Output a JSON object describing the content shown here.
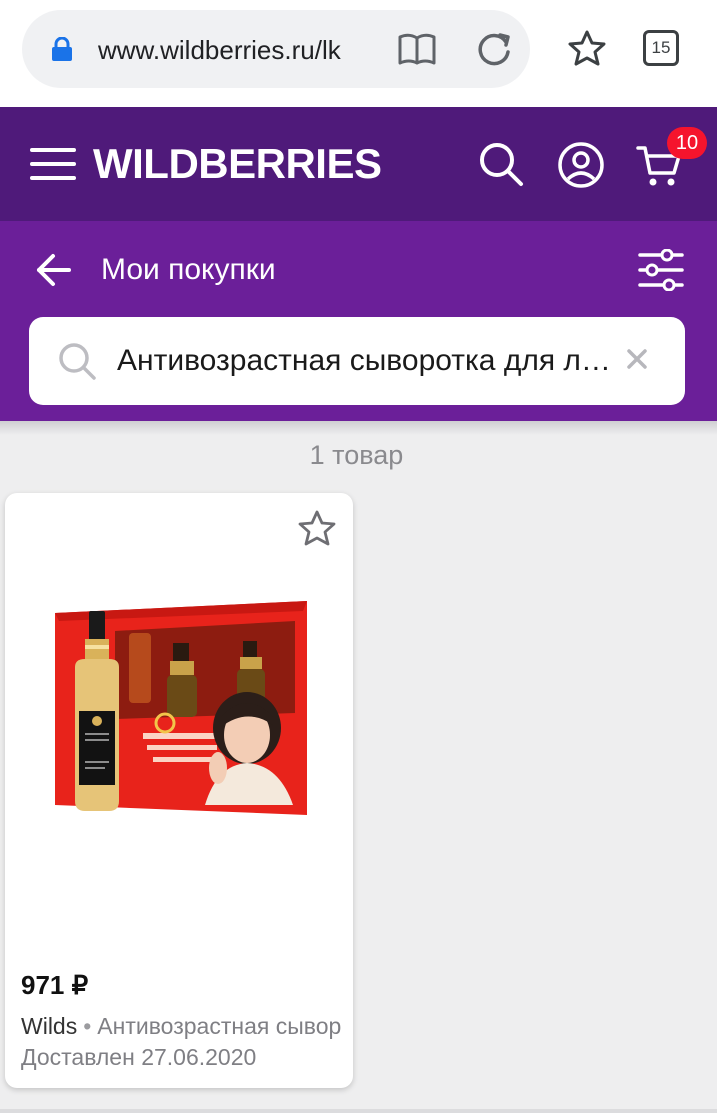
{
  "browser": {
    "url": "www.wildberries.ru/lk",
    "tab_count": "15",
    "icons": [
      "lock-icon",
      "reader-mode-icon",
      "reload-icon",
      "bookmark-star-icon",
      "tabs-icon"
    ]
  },
  "header": {
    "logo": "WILDBERRIES",
    "cart_badge": "10",
    "colors": {
      "header_bg": "#4f1a7a",
      "subheader_bg": "#6b1f99",
      "badge": "#f5142d"
    }
  },
  "page": {
    "title": "Мои покупки",
    "search_value": "Антивозрастная сыворотка для лица",
    "result_count": "1 товар"
  },
  "products": [
    {
      "price": "971 ₽",
      "brand": "Wilds",
      "separator": "•",
      "name": "Антивозрастная сыворотка для лица",
      "status": "Доставлен 27.06.2020"
    }
  ]
}
